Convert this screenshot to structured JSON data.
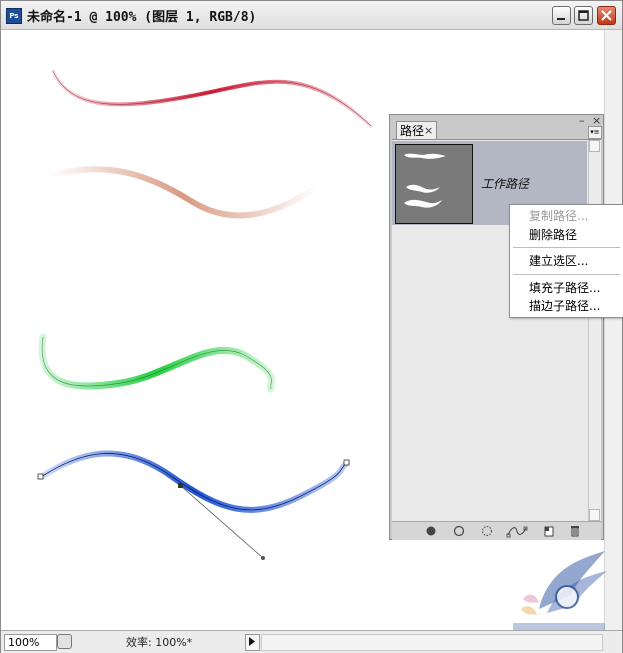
{
  "window": {
    "title": "未命名-1 @ 100% (图层 1, RGB/8)",
    "app_icon_label": "Ps"
  },
  "status_bar": {
    "zoom": "100%",
    "info": "效率: 100%*"
  },
  "paths_panel": {
    "tab_label": "路径",
    "tab_close": "×",
    "collapse_glyph": "–",
    "close_glyph": "×",
    "menu_glyph": "▾≡",
    "items": [
      {
        "name": "工作路径"
      }
    ],
    "footer_icons": [
      "fill-path-icon",
      "stroke-path-icon",
      "load-selection-icon",
      "make-work-path-icon",
      "new-path-icon",
      "delete-path-icon"
    ]
  },
  "context_menu": {
    "items": [
      {
        "label": "复制路径...",
        "enabled": false
      },
      {
        "label": "删除路径",
        "enabled": true
      },
      {
        "label": "建立选区...",
        "enabled": true
      },
      {
        "label": "填充子路径...",
        "enabled": true
      },
      {
        "label": "描边子路径...",
        "enabled": true
      }
    ]
  },
  "strokes": [
    {
      "name": "red-stroke",
      "color": "#d8203c"
    },
    {
      "name": "tan-stroke",
      "color": "#d99a82"
    },
    {
      "name": "green-stroke",
      "color": "#27d144"
    },
    {
      "name": "blue-stroke",
      "color": "#2356d6"
    }
  ],
  "colors": {
    "panel_bg": "#c9c9c9",
    "selected_row": "#b3b7c4"
  }
}
